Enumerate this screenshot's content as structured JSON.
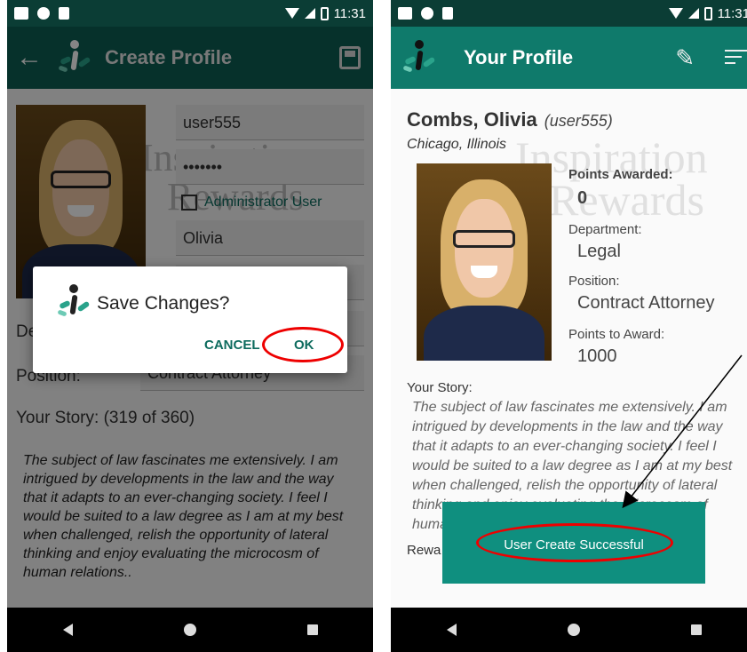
{
  "status_bar": {
    "time": "11:31"
  },
  "left_screen": {
    "title": "Create Profile",
    "username": "user555",
    "password": "•••••••",
    "admin_label": "Administrator User",
    "first_name": "Olivia",
    "watermark_line1": "Inspiration",
    "watermark_line2": "Rewards",
    "department_label_partial": "De",
    "position_label": "Position:",
    "position_value": "Contract Attorney",
    "story_label": "Your Story:  (319 of 360)",
    "story_text": "The subject of law fascinates me extensively. I am intrigued by developments in the law and the way that it adapts to an ever-changing society. I feel I would be suited to a law degree as I am at my best when challenged, relish the opportunity of lateral thinking and enjoy evaluating the microcosm of human relations..",
    "dialog": {
      "title": "Save Changes?",
      "cancel": "CANCEL",
      "ok": "OK"
    }
  },
  "right_screen": {
    "title": "Your Profile",
    "last_first": "Combs, Olivia",
    "username_paren": "(user555)",
    "location": "Chicago, Illinois",
    "points_awarded_label": "Points Awarded:",
    "points_awarded_value": "0",
    "department_label": "Department:",
    "department_value": "Legal",
    "position_label": "Position:",
    "position_value": "Contract Attorney",
    "points_to_award_label": "Points to Award:",
    "points_to_award_value": "1000",
    "story_label": "Your Story:",
    "story_text": "The subject of law fascinates me extensively. I am intrigued by developments in the law and the way that it adapts to an ever-changing society. I feel I would be suited to a law degree as I am at my best when challenged, relish the opportunity of lateral thinking and enjoy evaluating the microcosm of human relations..",
    "rewards_partial": "Rewa",
    "watermark_line1": "Inspiration",
    "watermark_line2": "Rewards",
    "toast": "User Create Successful"
  },
  "colors": {
    "primary": "#0f7a6b",
    "toast": "#0f8f7f",
    "annotation": "#e00000"
  }
}
